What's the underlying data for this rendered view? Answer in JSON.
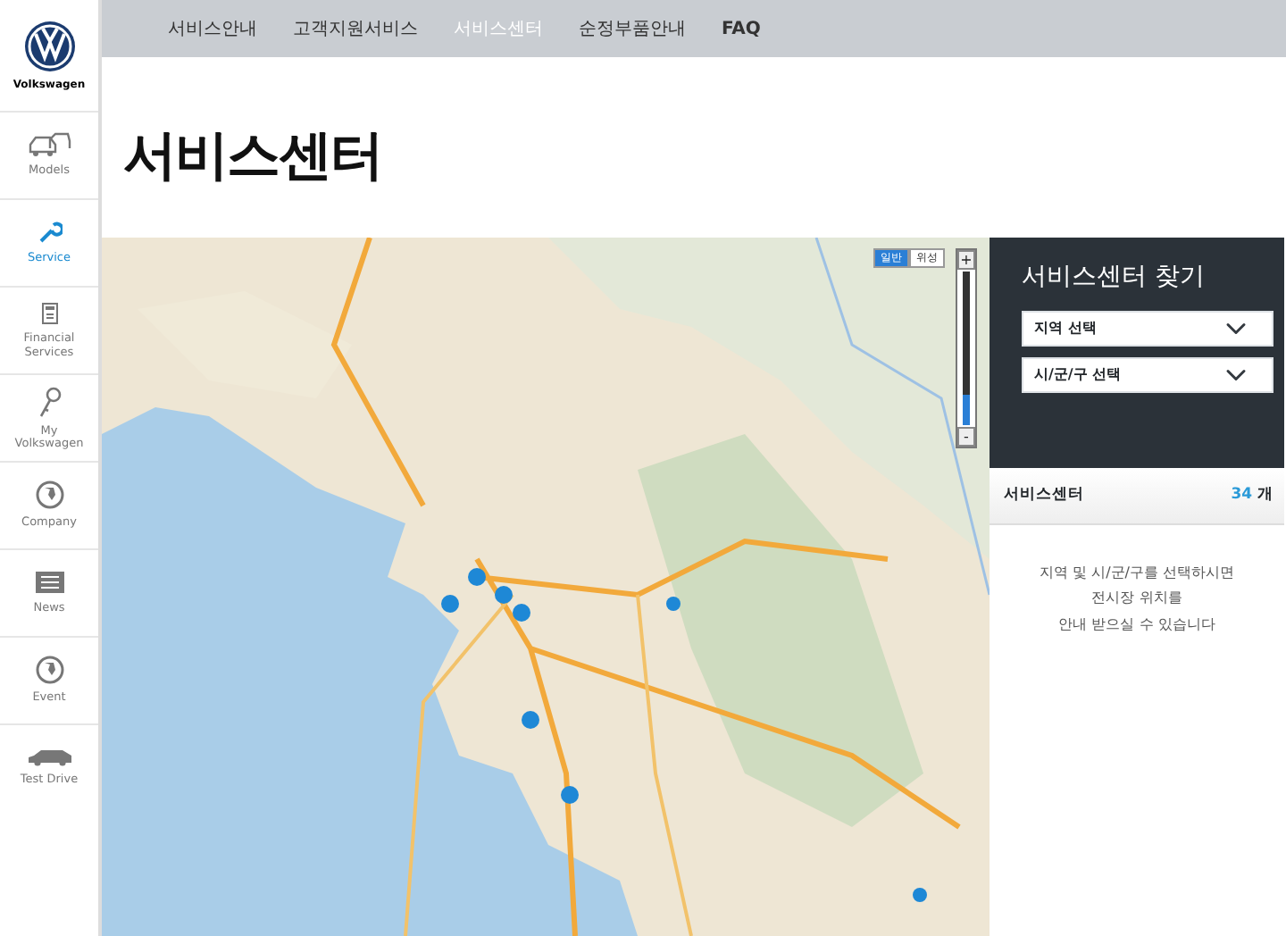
{
  "logo": {
    "text": "Volkswagen"
  },
  "sidebar": {
    "items": [
      {
        "label": "Models",
        "kind": "car",
        "selected": false
      },
      {
        "label": "Service",
        "kind": "wrench",
        "selected": true
      },
      {
        "label": "Financial Services",
        "kind": "calculator",
        "selected": false
      },
      {
        "label": "My Volkswagen",
        "kind": "key",
        "selected": false
      },
      {
        "label": "Company",
        "kind": "globe",
        "selected": false
      },
      {
        "label": "News",
        "kind": "news",
        "selected": false
      },
      {
        "label": "Event",
        "kind": "globe",
        "selected": false
      },
      {
        "label": "Test Drive",
        "kind": "wagon",
        "selected": false
      }
    ]
  },
  "top_nav": [
    {
      "label": "서비스안내",
      "selected": false,
      "bold": false
    },
    {
      "label": "고객지원서비스",
      "selected": false,
      "bold": false
    },
    {
      "label": "서비스센터",
      "selected": true,
      "bold": false
    },
    {
      "label": "순정부품안내",
      "selected": false,
      "bold": false
    },
    {
      "label": "FAQ",
      "selected": false,
      "bold": true
    }
  ],
  "page_title": "서비스센터",
  "map": {
    "kind": "picture",
    "map_types": [
      {
        "label": "일반",
        "selected": true
      },
      {
        "label": "위성",
        "selected": false
      }
    ],
    "zoom": {
      "plus": "+",
      "minus": "-",
      "level": 0.2
    }
  },
  "finder": {
    "title": "서비스센터 찾기",
    "selects": [
      {
        "value": "지역 선택"
      },
      {
        "value": "시/군/구 선택"
      }
    ]
  },
  "results": {
    "heading": "서비스센터",
    "count": "34",
    "unit": "개",
    "message": "지역 및 시/군/구를 선택하시면\n전시장 위치를\n안내 받으실 수 있습니다"
  }
}
